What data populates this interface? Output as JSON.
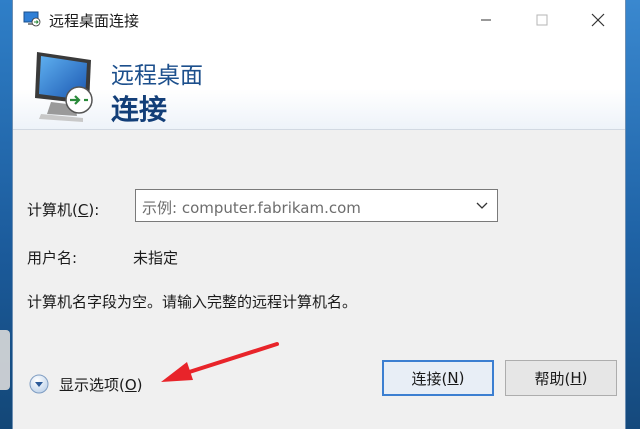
{
  "window": {
    "title": "远程桌面连接"
  },
  "banner": {
    "line1": "远程桌面",
    "line2": "连接"
  },
  "form": {
    "computer_label": "计算机(",
    "computer_key": "C",
    "computer_label_end": "):",
    "computer_placeholder": "示例: computer.fabrikam.com",
    "user_label": "用户名:",
    "user_value": "未指定",
    "message": "计算机名字段为空。请输入完整的远程计算机名。"
  },
  "options": {
    "label_start": "显示选项(",
    "key": "O",
    "label_end": ")"
  },
  "buttons": {
    "connect_start": "连接(",
    "connect_key": "N",
    "connect_end": ")",
    "help_start": "帮助(",
    "help_key": "H",
    "help_end": ")"
  },
  "colors": {
    "accent": "#3c7fd1",
    "banner_text": "#1c4f8c",
    "annotation_arrow": "#e8242a"
  },
  "icons": {
    "title": "remote-desktop-icon",
    "banner": "remote-desktop-monitor-icon",
    "options": "chevron-down-circle-icon",
    "combo": "chevron-down-icon"
  }
}
